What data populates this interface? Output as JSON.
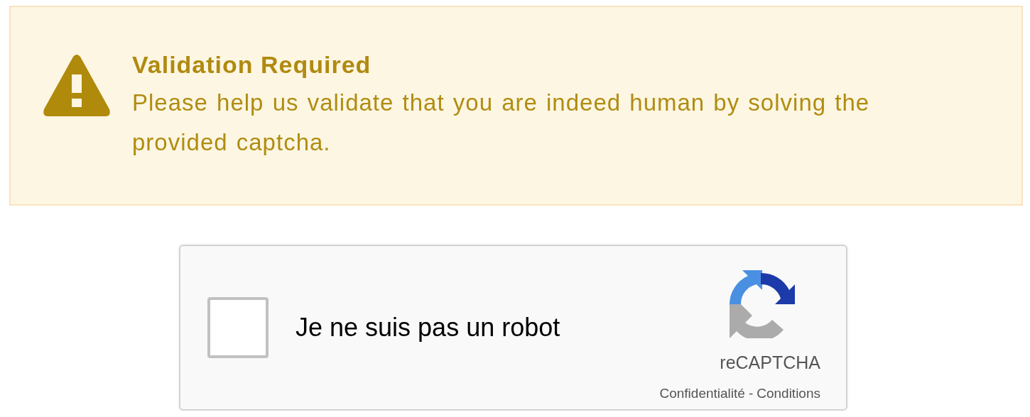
{
  "alert": {
    "title": "Validation Required",
    "message": "Please help us validate that you are indeed human by solving the provided captcha."
  },
  "captcha": {
    "checked": false,
    "label": "Je ne suis pas un robot",
    "brand": "reCAPTCHA",
    "links": [
      "Confidentialité",
      "Conditions"
    ],
    "separator": "-"
  }
}
